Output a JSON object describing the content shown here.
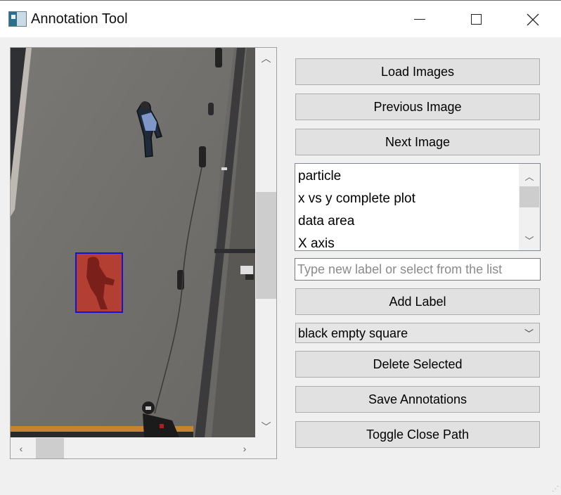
{
  "window": {
    "title": "Annotation Tool",
    "controls": {
      "minimize": "minimize",
      "maximize": "maximize",
      "close": "close"
    }
  },
  "viewer": {
    "annotation_box_color": "#1414d2",
    "annotation_fill_color": "#c23a2e",
    "vertical_scroll_position": 0.37,
    "horizontal_scroll_position": 0.1
  },
  "buttons": {
    "load_images": "Load Images",
    "previous_image": "Previous Image",
    "next_image": "Next Image",
    "add_label": "Add Label",
    "delete_selected": "Delete Selected",
    "save_annotations": "Save Annotations",
    "toggle_close_path": "Toggle Close Path"
  },
  "label_list": {
    "items": [
      "particle",
      "x vs y complete plot",
      "data area",
      "X axis"
    ]
  },
  "label_input": {
    "value": "",
    "placeholder": "Type new label or select from the list"
  },
  "shape_select": {
    "selected": "black empty square"
  }
}
